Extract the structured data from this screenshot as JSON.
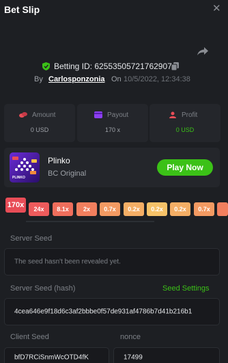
{
  "header": {
    "title": "Bet Slip",
    "close_glyph": "✕"
  },
  "bet": {
    "id_text": "Betting ID: 62553505721762907",
    "by_label": "By",
    "username": "Carlosponzonia",
    "on_label": "On",
    "date": "10/5/2022, 12:34:38"
  },
  "stats": {
    "amount_label": "Amount",
    "amount_value": "0 USD",
    "payout_label": "Payout",
    "payout_value": "170 x",
    "profit_label": "Profit",
    "profit_value": "0 USD"
  },
  "game": {
    "name": "Plinko",
    "provider": "BC Original",
    "play_label": "Play Now",
    "thumb_label": "PLINKO"
  },
  "multipliers": {
    "main": "170x",
    "row": [
      "24x",
      "8.1x",
      "2x",
      "0.7x",
      "0.2x",
      "0.2x",
      "0.2x",
      "0.7x"
    ]
  },
  "seeds": {
    "server_seed_label": "Server Seed",
    "server_seed_value": "The seed hasn't been revealed yet.",
    "server_seed_hash_label": "Server Seed (hash)",
    "seed_settings_label": "Seed Settings",
    "server_seed_hash_value": "4cea646e9f18d6c3af2bbbe0f57de931af4786b7d41b216b1",
    "client_seed_label": "Client Seed",
    "client_seed_value": "bfD7RCiSnmWcOTD4fK",
    "nonce_label": "nonce",
    "nonce_value": "17499"
  },
  "colors": {
    "accent_green": "#3bc117",
    "background": "#1d1f23",
    "profit_green": "#3bc117"
  }
}
